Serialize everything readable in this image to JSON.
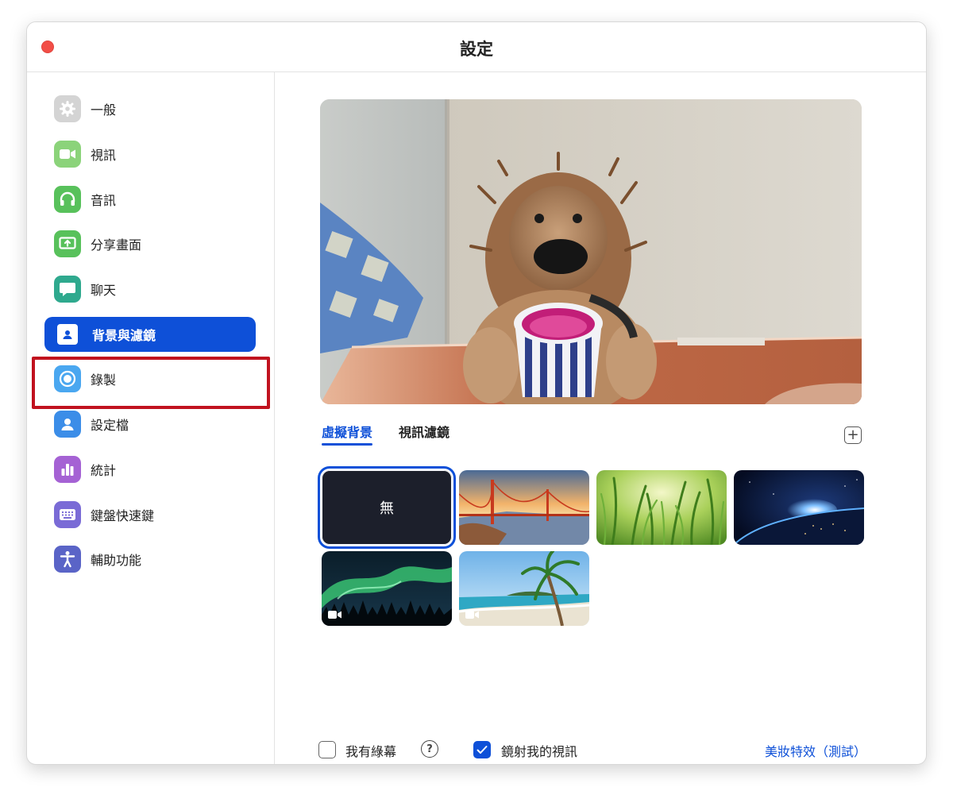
{
  "window": {
    "title": "設定"
  },
  "sidebar": {
    "items": [
      {
        "label": "一般",
        "icon": "gear-icon",
        "color": "#d4d4d4"
      },
      {
        "label": "視訊",
        "icon": "video-camera-icon",
        "color": "#8bd37a"
      },
      {
        "label": "音訊",
        "icon": "headphones-icon",
        "color": "#58c15b"
      },
      {
        "label": "分享畫面",
        "icon": "share-screen-icon",
        "color": "#58c15b"
      },
      {
        "label": "聊天",
        "icon": "chat-bubble-icon",
        "color": "#2fa98e"
      },
      {
        "label": "背景與濾鏡",
        "icon": "background-filter-icon",
        "color": "#ffffff",
        "active": true
      },
      {
        "label": "錄製",
        "icon": "record-icon",
        "color": "#4aa7f0"
      },
      {
        "label": "設定檔",
        "icon": "profile-icon",
        "color": "#3b8de8"
      },
      {
        "label": "統計",
        "icon": "statistics-icon",
        "color": "#a562d4"
      },
      {
        "label": "鍵盤快速鍵",
        "icon": "keyboard-icon",
        "color": "#7a6bd6"
      },
      {
        "label": "輔助功能",
        "icon": "accessibility-icon",
        "color": "#5a64c7"
      }
    ]
  },
  "main": {
    "tabs": [
      {
        "label": "虛擬背景",
        "active": true
      },
      {
        "label": "視訊濾鏡",
        "active": false
      }
    ],
    "add_button": "+",
    "backgrounds": [
      {
        "label": "無",
        "kind": "none",
        "selected": true
      },
      {
        "kind": "golden-gate-bridge-image"
      },
      {
        "kind": "grass-image"
      },
      {
        "kind": "earth-from-space-image"
      },
      {
        "kind": "aurora-image",
        "video": true
      },
      {
        "kind": "beach-palm-image",
        "video": true
      }
    ],
    "options": {
      "green_screen_label": "我有綠幕",
      "green_screen_checked": false,
      "mirror_label": "鏡射我的視訊",
      "mirror_checked": true,
      "beauty_link": "美妝特效（測試）"
    }
  },
  "colors": {
    "accent": "#0e50d8",
    "highlight": "#c1121f",
    "close": "#f24e47"
  }
}
